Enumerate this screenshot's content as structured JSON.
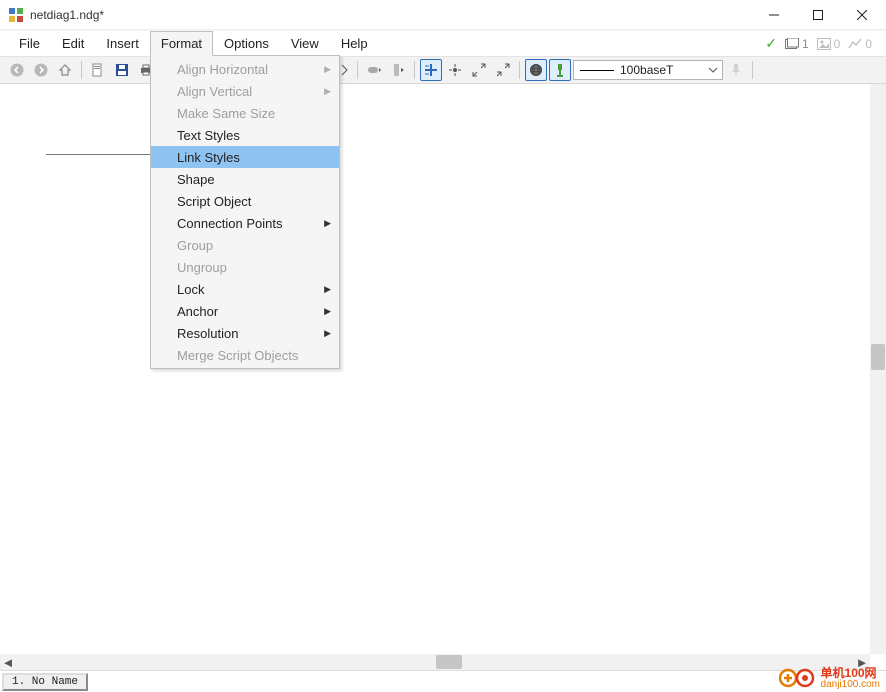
{
  "window": {
    "title": "netdiag1.ndg*"
  },
  "menubar": {
    "items": [
      "File",
      "Edit",
      "Insert",
      "Format",
      "Options",
      "View",
      "Help"
    ],
    "open_index": 3,
    "right": {
      "count1": "1",
      "count2": "0",
      "count3": "0"
    }
  },
  "toolbar": {
    "combo_value": "100baseT"
  },
  "dropdown": {
    "items": [
      {
        "label": "Align Horizontal",
        "disabled": true,
        "submenu": true
      },
      {
        "label": "Align Vertical",
        "disabled": true,
        "submenu": true
      },
      {
        "label": "Make Same Size",
        "disabled": true,
        "submenu": false
      },
      {
        "label": "Text Styles",
        "disabled": false,
        "submenu": false
      },
      {
        "label": "Link Styles",
        "disabled": false,
        "submenu": false,
        "highlight": true
      },
      {
        "label": "Shape",
        "disabled": false,
        "submenu": false
      },
      {
        "label": "Script Object",
        "disabled": false,
        "submenu": false
      },
      {
        "label": "Connection Points",
        "disabled": false,
        "submenu": true
      },
      {
        "label": "Group",
        "disabled": true,
        "submenu": false
      },
      {
        "label": "Ungroup",
        "disabled": true,
        "submenu": false
      },
      {
        "label": "Lock",
        "disabled": false,
        "submenu": true
      },
      {
        "label": "Anchor",
        "disabled": false,
        "submenu": true
      },
      {
        "label": "Resolution",
        "disabled": false,
        "submenu": true
      },
      {
        "label": "Merge Script Objects",
        "disabled": true,
        "submenu": false
      }
    ]
  },
  "status": {
    "sheet_tab": "1. No Name"
  },
  "watermark": {
    "line1": "单机100网",
    "line2": "danji100.com"
  }
}
